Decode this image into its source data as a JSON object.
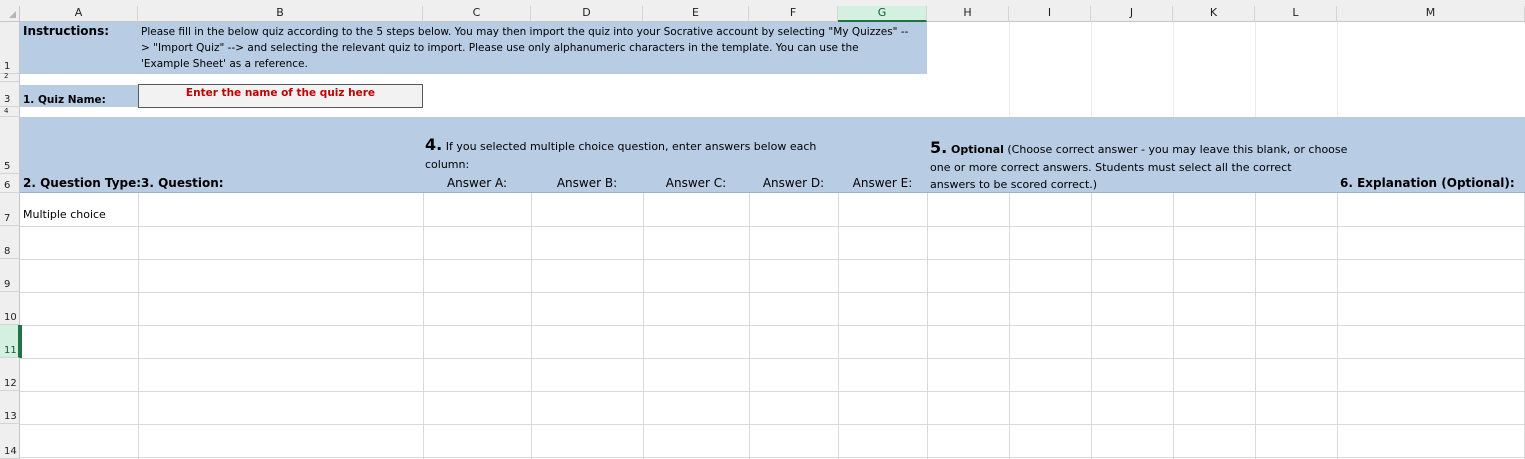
{
  "columns": [
    "A",
    "B",
    "C",
    "D",
    "E",
    "F",
    "G",
    "H",
    "I",
    "J",
    "K",
    "L",
    "M"
  ],
  "selected_column": "G",
  "rows": [
    "1",
    "2",
    "3",
    "4",
    "5",
    "6",
    "7",
    "8",
    "9",
    "10",
    "11",
    "12",
    "13",
    "14"
  ],
  "selected_row": "11",
  "instructions": {
    "label": "Instructions:",
    "line1": "Please fill in the below quiz according to the 5 steps below. You may then import the quiz into your Socrative account by selecting \"My Quizzes\" --",
    "line2": "> \"Import Quiz\" --> and selecting the relevant quiz to import. Please use only alphanumeric characters in the template.  You can use the",
    "line3": "'Example Sheet' as a reference."
  },
  "quiz_name": {
    "label": "1. Quiz Name:",
    "placeholder": "Enter the name of the quiz here"
  },
  "step4": {
    "number": "4.",
    "text_line1": " If you selected multiple choice question, enter answers below each",
    "text_line2": "column:"
  },
  "step5": {
    "number": "5.",
    "bold": " Optional",
    "text_line1": " (Choose correct answer - you may leave this blank, or choose",
    "text_line2": "one or more correct answers.  Students must select all the correct",
    "text_line3": "answers to be scored correct.)"
  },
  "headers": {
    "question_type": "2. Question Type:",
    "question": "3. Question:",
    "answer_a": "Answer A:",
    "answer_b": "Answer B:",
    "answer_c": "Answer C:",
    "answer_d": "Answer D:",
    "answer_e": "Answer E:",
    "explanation": "6. Explanation (Optional):"
  },
  "row7": {
    "question_type": "Multiple choice"
  },
  "colors": {
    "header_blue": "#b8cce4",
    "quiz_placeholder_red": "#c00000",
    "selection_green": "#217346"
  }
}
